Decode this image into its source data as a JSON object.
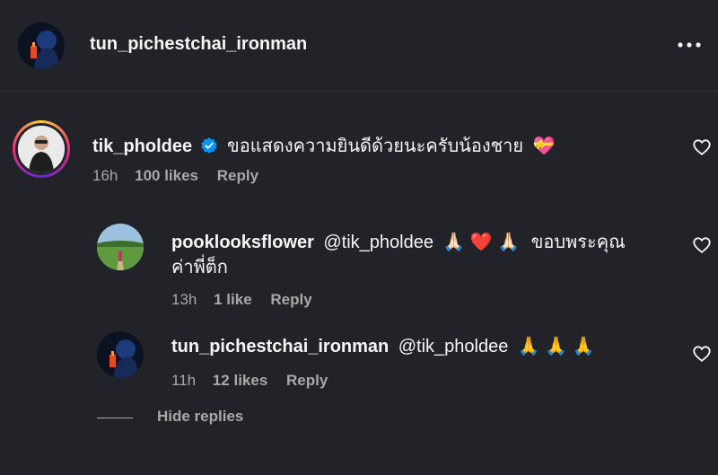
{
  "header": {
    "username": "tun_pichestchai_ironman",
    "more_label": "•••"
  },
  "comment": {
    "username": "tik_pholdee",
    "text": "ขอแสดงความยินดีด้วยนะครับน้องชาย",
    "emoji": "💝",
    "time": "16h",
    "likes": "100 likes",
    "reply": "Reply"
  },
  "replies": [
    {
      "username": "pooklooksflower",
      "mention": "@tik_pholdee",
      "emojis": "🙏🏻 ❤️ 🙏🏻",
      "text_line1": "ขอบพระคุณ",
      "text_line2": "ค่าพี่ต็ก",
      "time": "13h",
      "likes": "1 like",
      "reply": "Reply"
    },
    {
      "username": "tun_pichestchai_ironman",
      "mention": "@tik_pholdee",
      "emojis": "🙏 🙏 🙏",
      "time": "11h",
      "likes": "12 likes",
      "reply": "Reply"
    }
  ],
  "hide_replies": "Hide replies",
  "colors": {
    "background": "#212328",
    "mention": "#8c9cff",
    "verified": "#0095f6",
    "story_ring_start": "#f9ce34",
    "story_ring_end": "#ee2a7b"
  }
}
